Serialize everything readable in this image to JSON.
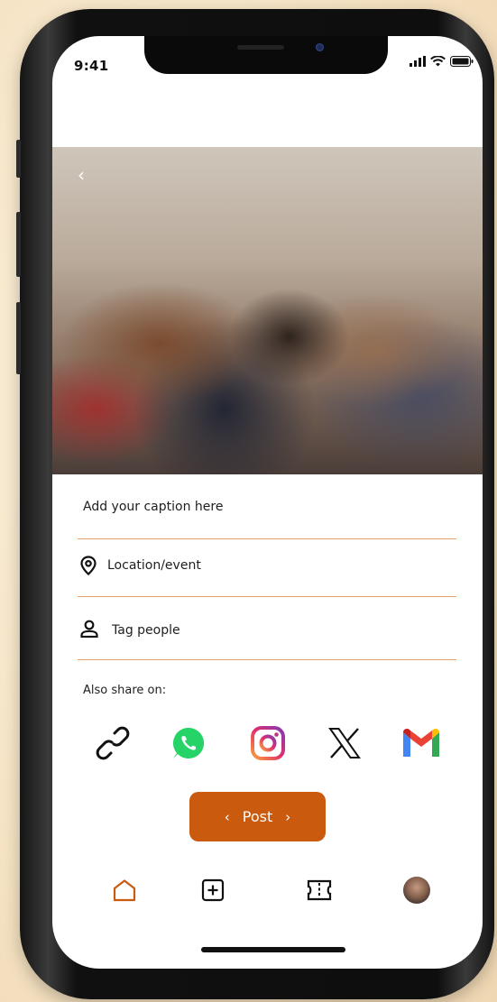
{
  "status_bar": {
    "time": "9:41"
  },
  "photo": {
    "alt_label": ""
  },
  "form": {
    "caption_placeholder": "Add your caption here",
    "location_placeholder": "Location/event",
    "tag_placeholder": "Tag people"
  },
  "share": {
    "label": "Also share on:",
    "targets": [
      "link-icon",
      "whatsapp-icon",
      "instagram-icon",
      "x-icon",
      "gmail-icon"
    ]
  },
  "post_button": {
    "label": "Post"
  },
  "bottom_nav": {
    "items": [
      "home-icon",
      "add-post-icon",
      "ticket-icon",
      "profile-avatar"
    ],
    "active": "home-icon"
  },
  "colors": {
    "accent": "#c95a0e",
    "divider": "#e3a36a",
    "whatsapp": "#25d366"
  }
}
